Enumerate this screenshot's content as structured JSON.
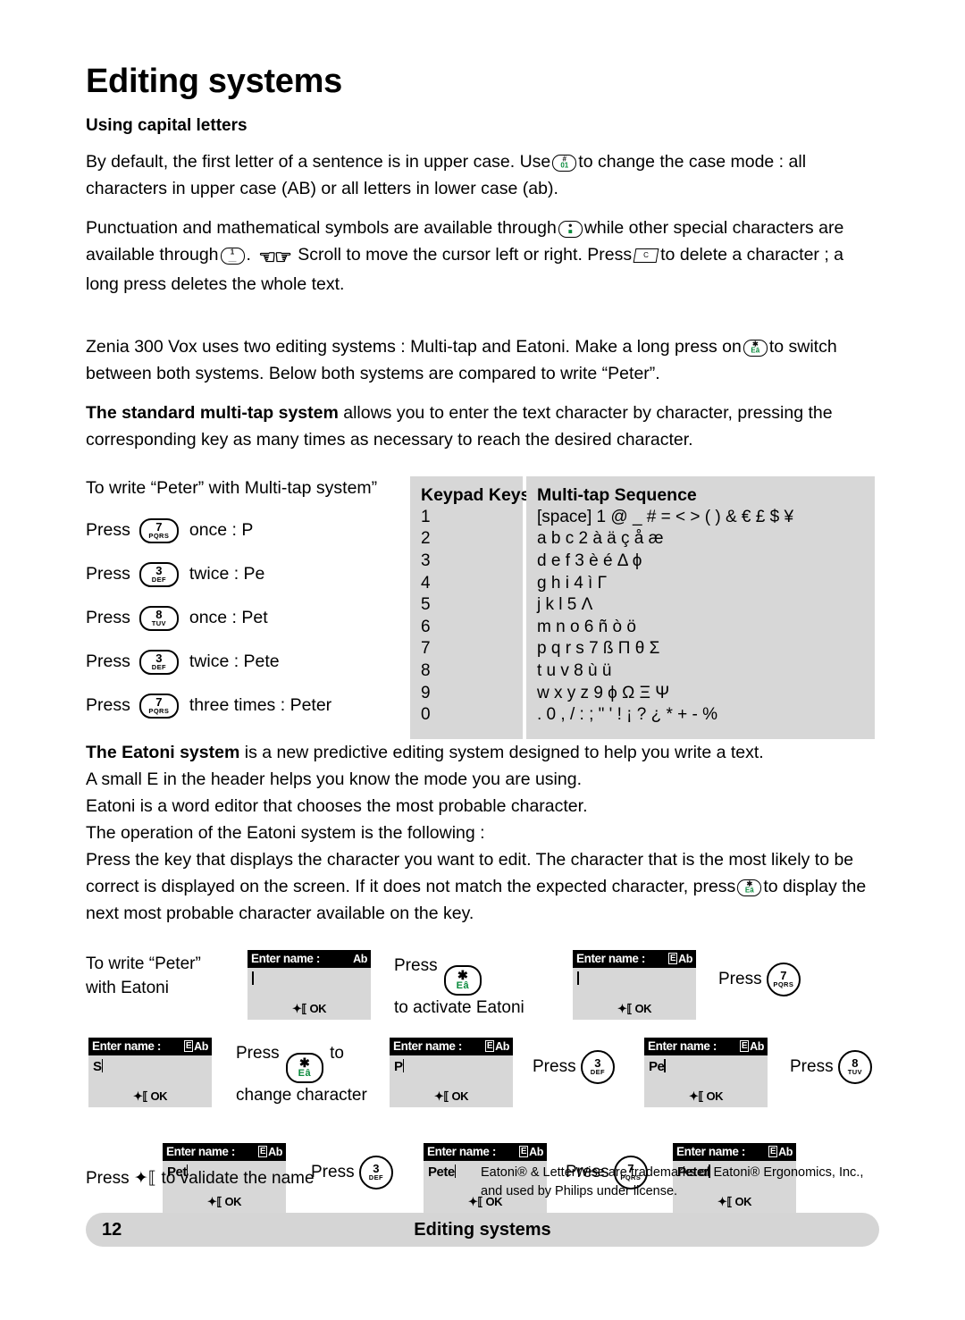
{
  "page": {
    "title": "Editing systems",
    "subheading": "Using capital letters",
    "footer": {
      "page_number": "12",
      "section": "Editing systems"
    }
  },
  "paragraphs": {
    "p1_a": "By default, the first letter of a sentence is in upper case. Use",
    "p1_b": "to change the case mode : all characters in upper case (AB) or all letters in lower case (ab).",
    "p2_a": "Punctuation and mathematical symbols are available through",
    "p2_b": "while other special characters are available through",
    "p2_c": ".",
    "p2_d": "Scroll to move the cursor left or right. Press",
    "p2_e": "to delete a character ; a long press deletes the whole text.",
    "p3_a": "Zenia 300 Vox uses two editing systems : Multi-tap and Eatoni. Make a long press on",
    "p3_b": "to switch between both systems. Below both systems are compared to write “Peter”.",
    "p4_bold": "The standard multi-tap system",
    "p4_rest": "allows you to enter the text character by character, pressing the corresponding key as many times as necessary to reach the desired character.",
    "p5_bold": "The Eatoni system",
    "p5_rest": "is a new predictive editing system designed to help you write a text.",
    "p6": "A small E in the header helps you know the mode you are using.",
    "p7": "Eatoni is a word editor that chooses the most probable character.",
    "p8": "The operation of the Eatoni system is the following :",
    "p9_a": "Press the key that displays the character you want to edit. The character that is the most likely to be correct is displayed on the screen. If it does not match the expected character, press",
    "p9_b": "to display the next most probable character available on the key."
  },
  "icons": {
    "case_key": "case-mode-key-icon",
    "symbol_key": "symbol-key-icon",
    "one_key": "key-1-icon",
    "scroll": "scroll-left-right-icon",
    "delete_key": "clear-key-icon",
    "star_key": "star-eatoni-key-icon",
    "validate_arrow": "✦⸦"
  },
  "multitap": {
    "intro": "To write “Peter” with Multi-tap system”",
    "steps": [
      {
        "press": "Press",
        "key_num": "7",
        "key_alpha": "PQRS",
        "result": "once : P"
      },
      {
        "press": "Press",
        "key_num": "3",
        "key_alpha": "DEF",
        "result": "twice : Pe"
      },
      {
        "press": "Press",
        "key_num": "8",
        "key_alpha": "TUV",
        "result": "once : Pet"
      },
      {
        "press": "Press",
        "key_num": "3",
        "key_alpha": "DEF",
        "result": "twice : Pete"
      },
      {
        "press": "Press",
        "key_num": "7",
        "key_alpha": "PQRS",
        "result": "three times : Peter"
      }
    ],
    "table": {
      "header_keys": "Keypad Keys",
      "header_sequence": "Multi-tap Sequence",
      "rows": [
        {
          "key": "1",
          "sequence": "[space] 1 @ _ # = < > ( ) & € £ $ ¥"
        },
        {
          "key": "2",
          "sequence": "a b c 2 à ä ç å æ"
        },
        {
          "key": "3",
          "sequence": "d e f 3 è é Δ ϕ"
        },
        {
          "key": "4",
          "sequence": "g h i 4 ì Γ"
        },
        {
          "key": "5",
          "sequence": "j k l 5 Λ"
        },
        {
          "key": "6",
          "sequence": "m n o 6 ñ ò ö"
        },
        {
          "key": "7",
          "sequence": "p q r s 7 ß Π θ Σ"
        },
        {
          "key": "8",
          "sequence": "t u v 8 ù ü"
        },
        {
          "key": "9",
          "sequence": "w x y z 9 ϕ Ω Ξ Ψ"
        },
        {
          "key": "0",
          "sequence": ". 0 , / : ; \" ' ! ¡ ? ¿ * + - %"
        }
      ]
    }
  },
  "eatoni": {
    "intro_line1": "To write “Peter”",
    "intro_line2": "with Eatoni",
    "screens": [
      {
        "header": "Enter name :",
        "mode": "Ab",
        "eatoni_badge": false,
        "typed": "",
        "softkey": "OK"
      },
      {
        "header": "Enter name :",
        "mode": "Ab",
        "eatoni_badge": true,
        "typed": "",
        "softkey": "OK"
      },
      {
        "header": "Enter name :",
        "mode": "Ab",
        "eatoni_badge": true,
        "typed": "S",
        "softkey": "OK"
      },
      {
        "header": "Enter name :",
        "mode": "Ab",
        "eatoni_badge": true,
        "typed": "P",
        "softkey": "OK"
      },
      {
        "header": "Enter name :",
        "mode": "Ab",
        "eatoni_badge": true,
        "typed": "Pe",
        "softkey": "OK"
      },
      {
        "header": "Enter name :",
        "mode": "Ab",
        "eatoni_badge": true,
        "typed": "Pet",
        "softkey": "OK"
      },
      {
        "header": "Enter name :",
        "mode": "Ab",
        "eatoni_badge": true,
        "typed": "Pete",
        "softkey": "OK"
      },
      {
        "header": "Enter name :",
        "mode": "Ab",
        "eatoni_badge": true,
        "typed": "Peter",
        "softkey": "OK"
      }
    ],
    "actions": {
      "a1_press": "Press",
      "a1_after": "to activate Eatoni",
      "a2_press": "Press",
      "a2_key_num": "7",
      "a2_key_alpha": "PQRS",
      "a3_press": "Press",
      "a3_after_l1": "to",
      "a3_after_l2": "change character",
      "a4_press": "Press",
      "a4_key_num": "3",
      "a4_key_alpha": "DEF",
      "a5_press": "Press",
      "a5_key_num": "8",
      "a5_key_alpha": "TUV",
      "a6_press": "Press",
      "a6_key_num": "3",
      "a6_key_alpha": "DEF",
      "a7_press": "Press",
      "a7_key_num": "7",
      "a7_key_alpha": "PQRS"
    },
    "validate_a": "Press",
    "validate_b": "to validate the name",
    "trademark_l1": "Eatoni® & LetterWise are trademarks of Eatoni® Ergonomics, Inc.,",
    "trademark_l2": "and used by Philips under license."
  }
}
